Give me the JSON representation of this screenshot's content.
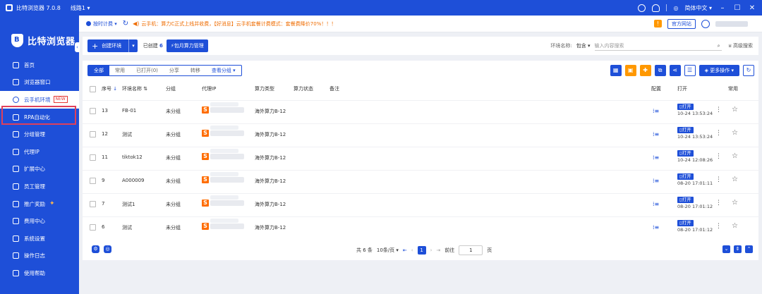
{
  "window": {
    "app_title": "比特浏览器 7.0.8",
    "line_selector": "线路1 ▾",
    "language": "简体中文 ▾",
    "minimize": "–",
    "maximize": "☐",
    "close": "✕"
  },
  "brand": {
    "name": "比特浏览器"
  },
  "sidebar": {
    "items": [
      {
        "label": "首页"
      },
      {
        "label": "浏览器窗口"
      },
      {
        "label": "云手机环境",
        "badge": "NEW"
      },
      {
        "label": "RPA自动化"
      },
      {
        "label": "分组管理"
      },
      {
        "label": "代理IP"
      },
      {
        "label": "扩展中心"
      },
      {
        "label": "员工管理"
      },
      {
        "label": "推广奖励"
      },
      {
        "label": "费用中心"
      },
      {
        "label": "系统设置"
      },
      {
        "label": "操作日志"
      },
      {
        "label": "使用帮助"
      }
    ]
  },
  "notice": {
    "timer_label": "按时计费 ▾",
    "message": "云手机：算力C正式上线并收费，【好消息】云手机套餐计费模式：套餐费降价70%！！！",
    "official_site": "官方网站"
  },
  "toolbar": {
    "create_label": "创建环境",
    "created_text": "已创建",
    "created_count": "6",
    "monthly_label": "包月算力管理",
    "search_label": "环境名称:",
    "search_mode": "包含 ▾",
    "search_placeholder": "输入内容搜索",
    "advanced_label": "高级搜索"
  },
  "tabs": [
    "全部",
    "常用",
    "已打开(0)",
    "分享",
    "转移",
    "查看分组 ▾"
  ],
  "actions": {
    "more_label": "更多操作 ▾"
  },
  "table": {
    "headers": {
      "seq": "序号",
      "env_name": "环境名称",
      "group": "分组",
      "proxy": "代理IP",
      "compute_type": "算力类型",
      "compute_status": "算力状态",
      "remark": "备注",
      "config": "配置",
      "open": "打开",
      "fav": "常用"
    },
    "rows": [
      {
        "seq": "13",
        "name": "FB-01",
        "group": "未分组",
        "compute": "海外算力B-12",
        "open_label": "打开",
        "time": "10-24 13:53:24"
      },
      {
        "seq": "12",
        "name": "测试",
        "group": "未分组",
        "compute": "海外算力B-12",
        "open_label": "打开",
        "time": "10-24 13:53:24"
      },
      {
        "seq": "11",
        "name": "tiktok12",
        "group": "未分组",
        "compute": "海外算力B-12",
        "open_label": "打开",
        "time": "10-24 12:08:26"
      },
      {
        "seq": "9",
        "name": "A000009",
        "group": "未分组",
        "compute": "海外算力B-12",
        "open_label": "打开",
        "time": "08-20 17:01:11"
      },
      {
        "seq": "7",
        "name": "测试1",
        "group": "未分组",
        "compute": "海外算力B-12",
        "open_label": "打开",
        "time": "08-20 17:01:12"
      },
      {
        "seq": "6",
        "name": "测试",
        "group": "未分组",
        "compute": "海外算力B-12",
        "open_label": "打开",
        "time": "08-20 17:01:12"
      }
    ]
  },
  "pager": {
    "total": "共 6 条",
    "page_size": "10条/页 ▾",
    "current": "1",
    "goto_label": "前往",
    "goto_value": "1",
    "page_unit": "页"
  },
  "colors": {
    "primary": "#1e4fd8",
    "warning": "#ff9800",
    "proxy": "#ff6d00",
    "highlight": "#e0405a"
  }
}
